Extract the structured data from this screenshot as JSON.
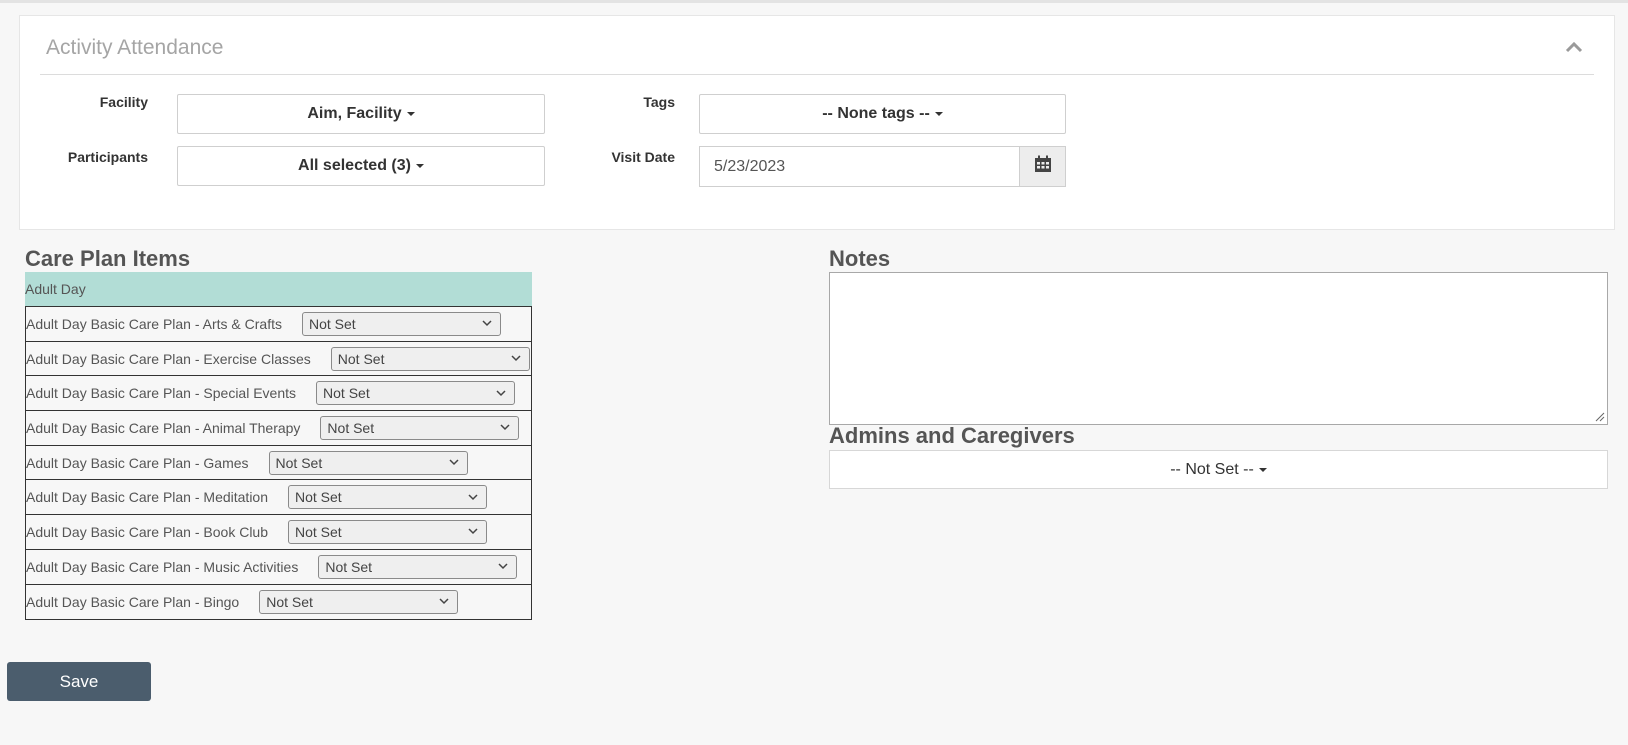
{
  "panel": {
    "title": "Activity Attendance"
  },
  "filters": {
    "facility_label": "Facility",
    "facility_value": "Aim, Facility",
    "tags_label": "Tags",
    "tags_value": "-- None tags --",
    "participants_label": "Participants",
    "participants_value": "All selected (3)",
    "visit_date_label": "Visit Date",
    "visit_date_value": "5/23/2023"
  },
  "care_plan": {
    "heading": "Care Plan Items",
    "group": "Adult Day",
    "items": [
      {
        "label": "Adult Day Basic Care Plan - Arts & Crafts",
        "value": "Not Set"
      },
      {
        "label": "Adult Day Basic Care Plan - Exercise Classes",
        "value": "Not Set"
      },
      {
        "label": "Adult Day Basic Care Plan - Special Events",
        "value": "Not Set"
      },
      {
        "label": "Adult Day Basic Care Plan - Animal Therapy",
        "value": "Not Set"
      },
      {
        "label": "Adult Day Basic Care Plan - Games",
        "value": "Not Set"
      },
      {
        "label": "Adult Day Basic Care Plan - Meditation",
        "value": "Not Set"
      },
      {
        "label": "Adult Day Basic Care Plan - Book Club",
        "value": "Not Set"
      },
      {
        "label": "Adult Day Basic Care Plan - Music Activities",
        "value": "Not Set"
      },
      {
        "label": "Adult Day Basic Care Plan - Bingo",
        "value": "Not Set"
      }
    ]
  },
  "notes": {
    "heading": "Notes",
    "value": ""
  },
  "admins": {
    "heading": "Admins and Caregivers",
    "value": "-- Not Set --"
  },
  "actions": {
    "save_label": "Save"
  },
  "icons": {
    "collapse": "chevron-up-icon",
    "calendar": "calendar-icon",
    "caret": "caret-down-icon",
    "select_chevron": "chevron-down-icon"
  },
  "colors": {
    "group_header": "#b2ddd6",
    "save_button": "#4b5d6d"
  }
}
